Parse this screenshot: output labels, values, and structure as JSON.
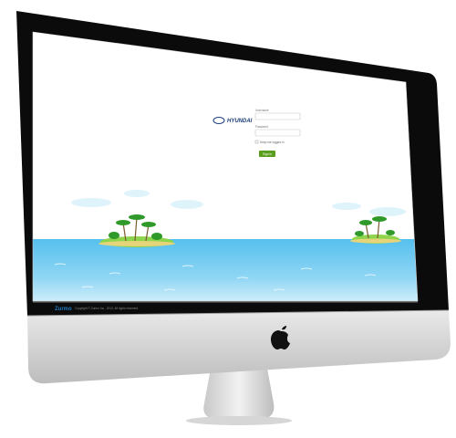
{
  "brand": {
    "name": "HYUNDAI"
  },
  "login": {
    "username_label": "Username",
    "password_label": "Password",
    "remember_label": "Keep me logged in",
    "signin_label": "Sign in"
  },
  "footer": {
    "logo": "Zurmo",
    "copyright": "Copyright © Zurmo Inc., 2013. All rights reserved."
  },
  "colors": {
    "brand_blue": "#1a3d7a",
    "signin_green": "#5a9e1f",
    "sea_top": "#5cc4ef",
    "sea_bottom": "#bfe8f8",
    "bezel": "#0d0d0d",
    "chin": "#d9d9d9"
  },
  "icons": {
    "hyundai_logo": "hyundai-h-oval",
    "apple_logo": "apple-logo",
    "island": "palm-island"
  }
}
